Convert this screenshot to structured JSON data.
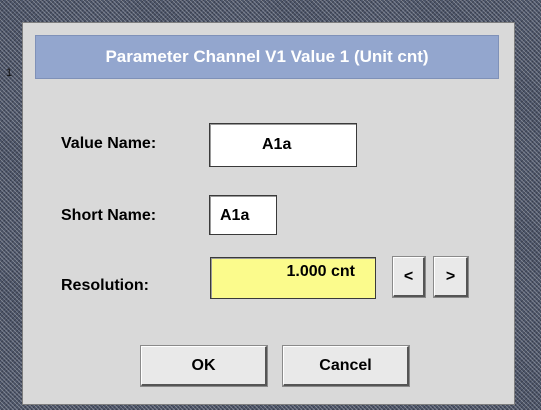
{
  "dialog": {
    "title": "Parameter Channel V1 Value 1 (Unit cnt)"
  },
  "fields": {
    "value_name": {
      "label": "Value Name:",
      "value": "A1a"
    },
    "short_name": {
      "label": "Short Name:",
      "value": "A1a"
    },
    "resolution": {
      "label": "Resolution:",
      "value": "1.000 cnt",
      "decrease": "<",
      "increase": ">"
    }
  },
  "buttons": {
    "ok": "OK",
    "cancel": "Cancel"
  },
  "background": {
    "edge_mark": "1"
  },
  "colors": {
    "title_bar": "#93a6ce",
    "dialog_bg": "#d9d9d9",
    "highlight_field": "#fbfb8c"
  }
}
